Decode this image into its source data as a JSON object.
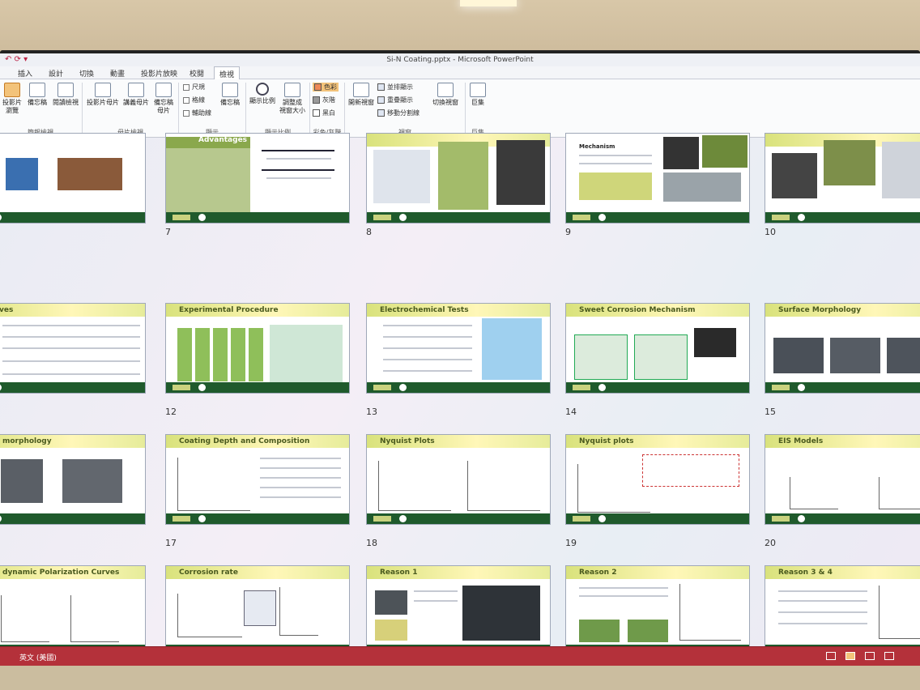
{
  "window": {
    "title": "Si-N Coating.pptx - Microsoft PowerPoint"
  },
  "tabs": [
    "插入",
    "設計",
    "切換",
    "動畫",
    "投影片放映",
    "校閱",
    "檢視"
  ],
  "ribbon": {
    "buttons": {
      "normal": "投影片\n瀏覽",
      "notes": "備忘稿",
      "reading": "閱讀檢視",
      "slide_master": "投影片母片",
      "handout_master": "講義母片",
      "notes_master": "備忘稿\n母片",
      "notes_page": "備忘稿",
      "zoom": "顯示比例",
      "fit": "調整成\n視窗大小",
      "new_window": "開新視窗",
      "switch_windows": "切換視窗",
      "macros": "巨集"
    },
    "checks": [
      "尺規",
      "格線",
      "輔助線"
    ],
    "color_opts": [
      "色彩",
      "灰階",
      "黑白"
    ],
    "window_opts": [
      "並排顯示",
      "重疊顯示",
      "移動分割線"
    ],
    "groups": [
      "簡報檢視",
      "母片檢視",
      "顯示",
      "顯示比例",
      "彩色/灰階",
      "視窗",
      "巨集"
    ]
  },
  "slides": [
    {
      "num": "",
      "title": ""
    },
    {
      "num": "7",
      "title": "Advantages"
    },
    {
      "num": "8",
      "title": ""
    },
    {
      "num": "9",
      "title": "Mechanism"
    },
    {
      "num": "10",
      "title": ""
    },
    {
      "num": "",
      "title": "ves"
    },
    {
      "num": "12",
      "title": "Experimental Procedure"
    },
    {
      "num": "13",
      "title": "Electrochemical Tests"
    },
    {
      "num": "14",
      "title": "Sweet Corrosion Mechanism"
    },
    {
      "num": "15",
      "title": "Surface Morphology"
    },
    {
      "num": "",
      "title": "morphology"
    },
    {
      "num": "17",
      "title": "Coating Depth and Composition"
    },
    {
      "num": "18",
      "title": "Nyquist Plots"
    },
    {
      "num": "19",
      "title": "Nyquist plots"
    },
    {
      "num": "20",
      "title": "EIS Models"
    },
    {
      "num": "",
      "title": "dynamic Polarization Curves"
    },
    {
      "num": "22",
      "title": "Corrosion rate"
    },
    {
      "num": "23",
      "title": "Reason 1"
    },
    {
      "num": "24",
      "title": "Reason 2"
    },
    {
      "num": "25",
      "title": "Reason 3 & 4"
    }
  ],
  "status": {
    "language": "英文 (美國)"
  },
  "colors": {
    "status_bar": "#b4313a",
    "slide_footer": "#1f5a2c",
    "header": "#d9e27c"
  }
}
